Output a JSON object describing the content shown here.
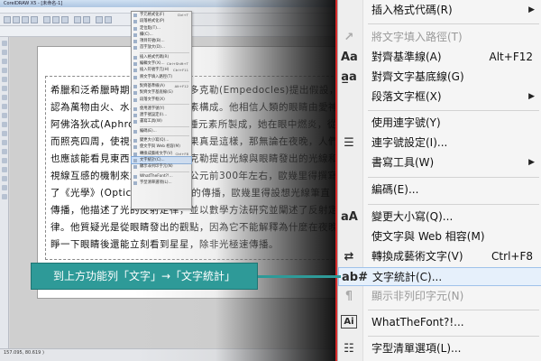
{
  "app": {
    "title": "CorelDRAW X5 - [未命名-1]",
    "status": "157.095, 80.619 )"
  },
  "document": {
    "paragraph": "希臘和泛希臘時期的哲學家恩培多克勒(Empedocles)提出假設，認為萬物由火、水、土、氣四元素構成。他相信人類的眼睛由愛神阿佛洛狄忒(Aphrodite)以這四種元素所製成，她在眼中燃炎，從而照亮四周，使視覺可能。但如果真是這樣，那無論在夜晚，人們也應該能看見東西，因此恩培多克勒提出光線與眼睛發出的光線和視線互感的機制來加以解釋。在公元前300年左右，歐幾里得撰寫了《光學》(Optica)中寫到了光的傳播，歐幾里得設想光線筆直傳播，他描述了光的反射定律，並以數學方法研究並闡述了反射定律。他質疑光是從眼睛發出的觀點，因為它不能解釋為什麼在夜晚睜一下眼睛後還能立刻看到星星，除非光極速傳播。"
  },
  "small_menu": {
    "items": [
      {
        "label": "字元格式化(F)",
        "key": "Ctrl+T"
      },
      {
        "label": "段落格式化(P)",
        "key": ""
      },
      {
        "label": "定位點(T)...",
        "key": ""
      },
      {
        "label": "欄(C)...",
        "key": ""
      },
      {
        "label": "項目符號(B)...",
        "key": ""
      },
      {
        "label": "首字放大(D)...",
        "key": ""
      },
      {
        "label": "插入格式代碼(R)",
        "key": ""
      },
      {
        "label": "編輯文字(X)...",
        "key": "Ctrl+Shift+T"
      },
      {
        "label": "插入符號字元(H)",
        "key": "Ctrl+F11"
      },
      {
        "label": "將文字填入路徑(T)",
        "key": ""
      },
      {
        "label": "對齊基準線(A)",
        "key": "Alt+F12"
      },
      {
        "label": "對齊文字基底線(G)",
        "key": ""
      },
      {
        "label": "段落文字框(X)",
        "key": ""
      },
      {
        "label": "使用連字號(Y)",
        "key": ""
      },
      {
        "label": "連字號設定(I)...",
        "key": ""
      },
      {
        "label": "書寫工具(W)",
        "key": ""
      },
      {
        "label": "編碼(E)...",
        "key": ""
      },
      {
        "label": "變更大小寫(Q)...",
        "key": ""
      },
      {
        "label": "使文字與 Web 相容(M)",
        "key": ""
      },
      {
        "label": "轉換成藝術文字(V)",
        "key": "Ctrl+F8"
      },
      {
        "label": "文字統計(C)...",
        "key": ""
      },
      {
        "label": "顯示非列印字元(N)",
        "key": ""
      },
      {
        "label": "WhatTheFont?!...",
        "key": ""
      },
      {
        "label": "字型清單選項(L)...",
        "key": ""
      }
    ]
  },
  "menu": {
    "insert_format_code": "插入格式代碼(R)",
    "fit_text_to_path": "將文字填入路徑(T)",
    "align_to_baseline": "對齊基準線(A)",
    "align_to_baseline_key": "Alt+F12",
    "straighten_text": "對齊文字基底線(G)",
    "paragraph_text_frame": "段落文字框(X)",
    "use_hyphenation": "使用連字號(Y)",
    "hyphenation_settings": "連字號設定(I)...",
    "writing_tools": "書寫工具(W)",
    "encode": "編碼(E)...",
    "change_case": "變更大小寫(Q)...",
    "make_web_compatible": "使文字與 Web 相容(M)",
    "convert_to_artistic": "轉換成藝術文字(V)",
    "convert_to_artistic_key": "Ctrl+F8",
    "text_statistics": "文字統計(C)...",
    "show_nonprinting": "顯示非列印字元(N)",
    "whatthefont": "WhatTheFont?!...",
    "font_list_options": "字型清單選項(L)..."
  },
  "icons": {
    "fit_text_to_path": "path-text-icon",
    "align_to_baseline": "baseline-text-icon",
    "straighten_text": "straighten-text-icon",
    "hyphenation_settings": "hyphen-settings-icon",
    "change_case": "change-case-icon",
    "convert_to_artistic": "convert-text-icon",
    "text_statistics": "text-statistics-icon",
    "show_nonprinting": "pilcrow-icon",
    "whatthefont": "whatthefont-icon",
    "font_list_options": "font-list-icon"
  },
  "callout": {
    "text": "到上方功能列「文字」→「文字統計」"
  },
  "colors": {
    "callout": "#2e9a98",
    "divider": "#d42a2a",
    "highlight": "#e6f0fb"
  }
}
